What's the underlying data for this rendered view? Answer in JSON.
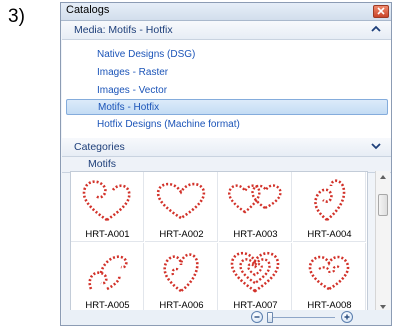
{
  "step_label": "3)",
  "window": {
    "title": "Catalogs"
  },
  "media_section": {
    "label": "Media: Motifs - Hotfix"
  },
  "media_items": [
    {
      "label": "Native Designs (DSG)"
    },
    {
      "label": "Images - Raster"
    },
    {
      "label": "Images - Vector"
    },
    {
      "label": "Motifs - Hotfix",
      "selected": true
    },
    {
      "label": "Hotfix Designs (Machine format)"
    }
  ],
  "categories_section": {
    "label": "Categories"
  },
  "motifs_section": {
    "label": "Motifs"
  },
  "motifs": [
    {
      "name": "HRT-A001"
    },
    {
      "name": "HRT-A002"
    },
    {
      "name": "HRT-A003"
    },
    {
      "name": "HRT-A004"
    },
    {
      "name": "HRT-A005"
    },
    {
      "name": "HRT-A006"
    },
    {
      "name": "HRT-A007"
    },
    {
      "name": "HRT-A008"
    }
  ],
  "colors": {
    "accent": "#1b54b8",
    "rhinestone": "#d2322a",
    "selection": "#c4dcf4"
  }
}
